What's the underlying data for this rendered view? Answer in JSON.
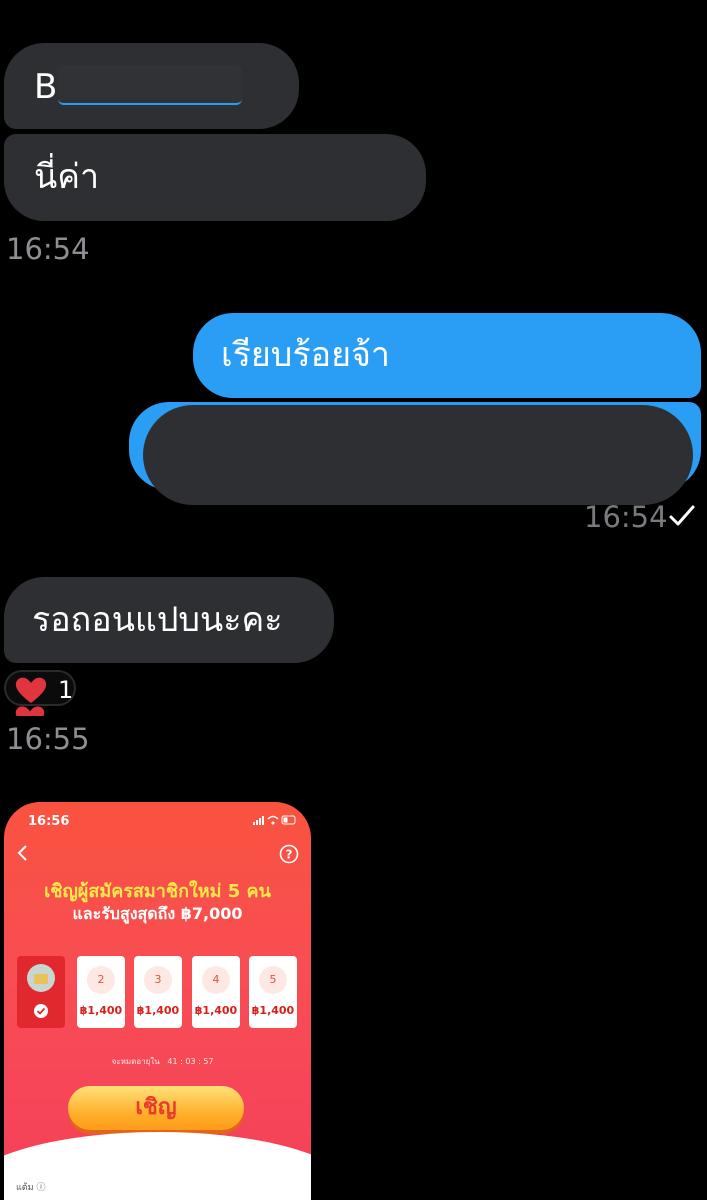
{
  "conversation": {
    "messages": [
      {
        "text": "B"
      },
      {
        "text": "นี่ค่า"
      },
      {
        "text": "เรียบร้อยจ้า"
      },
      {
        "text": ""
      },
      {
        "text": "รอถอนแปบนะคะ"
      }
    ],
    "timestamps": [
      "16:54",
      "16:54",
      "16:55"
    ],
    "reaction": {
      "icon": "heart-icon",
      "count": "1"
    }
  },
  "app_screenshot": {
    "status_time": "16:56",
    "headline": "เชิญผู้สมัครสมาชิกใหม่ 5 คน",
    "subline": "และรับสูงสุดถึง ฿7,000",
    "slots": [
      {
        "number": "2",
        "amount": "฿1,400"
      },
      {
        "number": "3",
        "amount": "฿1,400"
      },
      {
        "number": "4",
        "amount": "฿1,400"
      },
      {
        "number": "5",
        "amount": "฿1,400"
      }
    ],
    "countdown_label": "จะหมดอายุใน",
    "countdown": [
      "41",
      "03",
      "57"
    ],
    "invite_label": "เชิญ",
    "footer_label": "แต้ม"
  },
  "colors": {
    "incoming_bubble": "#2e2f32",
    "outgoing_bubble": "#2a9df4",
    "timestamp": "#8e8e93",
    "heart": "#e0343f"
  }
}
